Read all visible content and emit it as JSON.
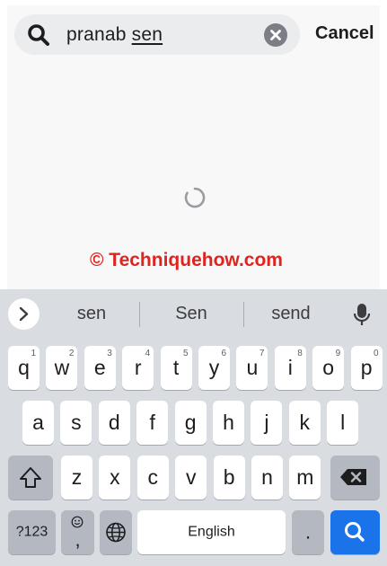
{
  "search": {
    "query_plain": "pranab ",
    "query_underlined": "sen",
    "cancel_label": "Cancel"
  },
  "watermark": "© Techniquehow.com",
  "keyboard": {
    "suggestions": [
      "sen",
      "Sen",
      "send"
    ],
    "row1": [
      {
        "ch": "q",
        "hint": "1"
      },
      {
        "ch": "w",
        "hint": "2"
      },
      {
        "ch": "e",
        "hint": "3"
      },
      {
        "ch": "r",
        "hint": "4"
      },
      {
        "ch": "t",
        "hint": "5"
      },
      {
        "ch": "y",
        "hint": "6"
      },
      {
        "ch": "u",
        "hint": "7"
      },
      {
        "ch": "i",
        "hint": "8"
      },
      {
        "ch": "o",
        "hint": "9"
      },
      {
        "ch": "p",
        "hint": "0"
      }
    ],
    "row2": [
      "a",
      "s",
      "d",
      "f",
      "g",
      "h",
      "j",
      "k",
      "l"
    ],
    "row3": [
      "z",
      "x",
      "c",
      "v",
      "b",
      "n",
      "m"
    ],
    "symbols_label": "?123",
    "comma_label": ",",
    "space_label": "English",
    "period_label": "."
  },
  "colors": {
    "accent": "#1a73e8",
    "watermark": "#e0231f"
  }
}
